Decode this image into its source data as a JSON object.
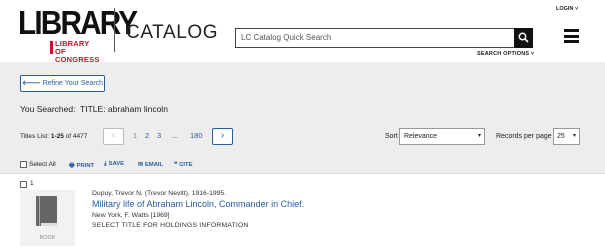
{
  "header": {
    "logo_main": "LIBRARY",
    "logo_sub_line1": "LIBRARY",
    "logo_sub_line2": "OF CONGRESS",
    "catalog_label": "CATALOG",
    "search_placeholder": "LC Catalog Quick Search",
    "search_options": "SEARCH OPTIONS ˅",
    "login": "LOGIN ˅"
  },
  "controls": {
    "refine_label": "Refine Your Search",
    "you_searched_prefix": "You Searched:",
    "you_searched_query": "TITLE: abraham lincoln",
    "titles_list_prefix": "Titles List:",
    "titles_range": "1-25",
    "titles_of": "of 4477",
    "pages": [
      "1",
      "2",
      "3",
      "...",
      "180"
    ],
    "prev_symbol": "‹",
    "next_symbol": "›",
    "sort_label": "Sort",
    "sort_value": "Relevance",
    "records_label": "Records per page",
    "records_value": "25",
    "select_all": "Select All",
    "print": "PRINT",
    "save": "SAVE",
    "email": "EMAIL",
    "cite": "CITE"
  },
  "results": [
    {
      "number": "1",
      "thumb_label": "BOOK",
      "author": "Dupuy, Trevor N. (Trevor Nevitt), 1916-1995.",
      "title": "Military life of Abraham Lincoln, Commander in Chief.",
      "publication": "New York, F. Watts [1969]",
      "holdings": "SELECT TITLE FOR HOLDINGS INFORMATION"
    }
  ],
  "colors": {
    "link_blue": "#2a5c9c",
    "logo_red": "#c8102e",
    "panel_gray": "#ededed"
  }
}
